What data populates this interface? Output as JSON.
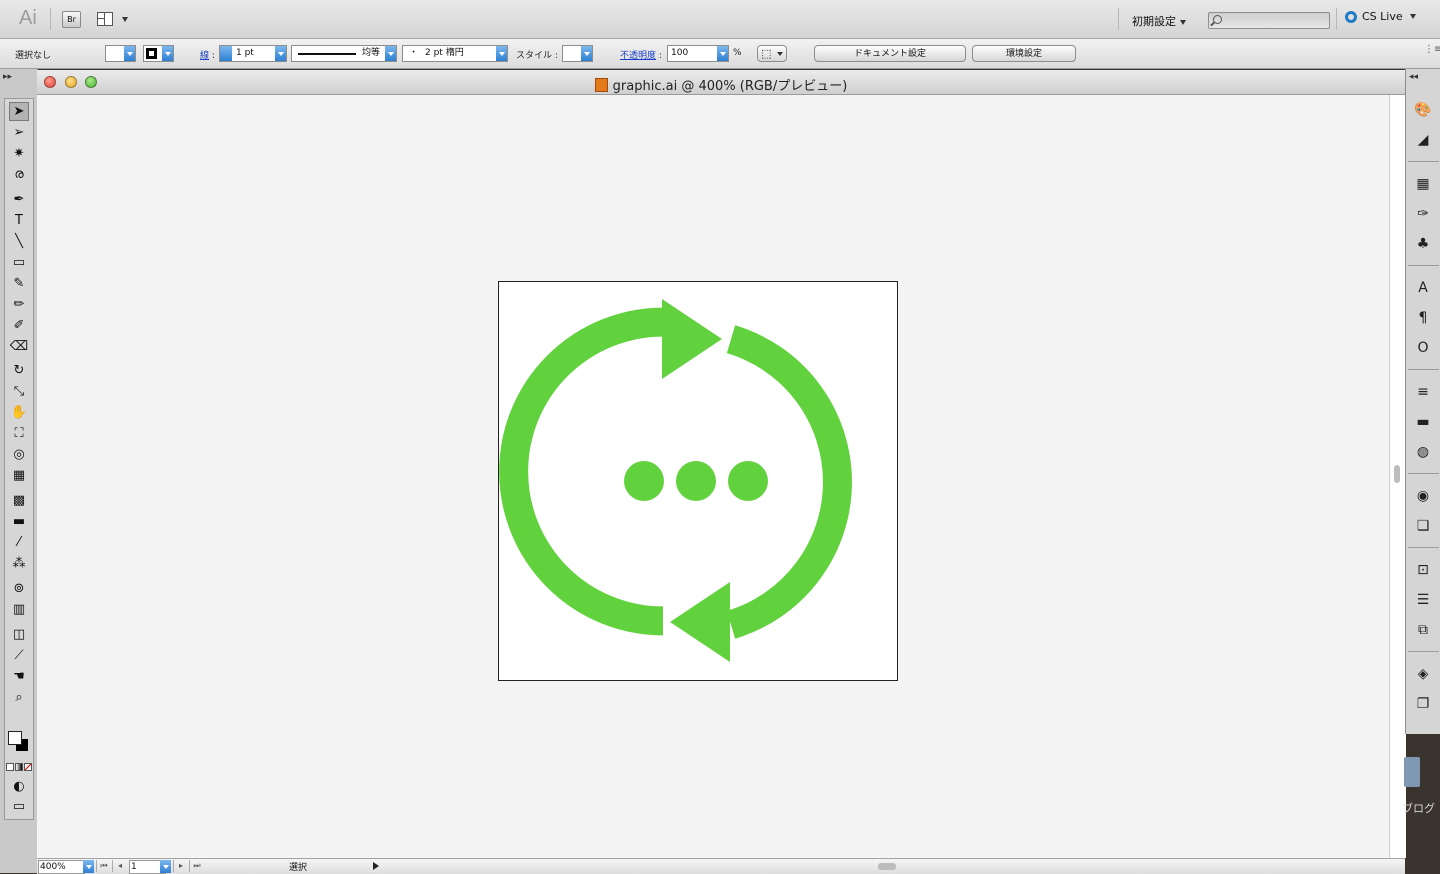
{
  "app": {
    "logo": "Ai",
    "bridge_button": "Br",
    "workspace_label": "初期設定",
    "search_placeholder": "",
    "cslive_label": "CS Live"
  },
  "control_bar": {
    "selection_label": "選択なし",
    "stroke_label": "線",
    "stroke_weight": "1 pt",
    "profile_label": "均等",
    "brush_label": "2 pt 楕円",
    "brush_prefix": "・",
    "style_label": "スタイル :",
    "opacity_label": "不透明度",
    "opacity_value": "100",
    "opacity_unit": "%",
    "document_setup_button": "ドキュメント設定",
    "preferences_button": "環境設定"
  },
  "document": {
    "title": "graphic.ai @ 400% (RGB/プレビュー)",
    "zoom_value": "400%",
    "page_value": "1",
    "status_text": "選択"
  },
  "artwork": {
    "accent_color": "#62d13e",
    "description_icon": "refresh-with-ellipsis"
  },
  "desktop": {
    "label": "ブログ"
  },
  "tools": [
    {
      "name": "selection-tool-icon",
      "glyph": "➤"
    },
    {
      "name": "direct-selection-tool-icon",
      "glyph": "➢"
    },
    {
      "name": "magic-wand-tool-icon",
      "glyph": "✷"
    },
    {
      "name": "lasso-tool-icon",
      "glyph": "ര"
    },
    {
      "name": "pen-tool-icon",
      "glyph": "✒"
    },
    {
      "name": "type-tool-icon",
      "glyph": "T"
    },
    {
      "name": "line-tool-icon",
      "glyph": "╲"
    },
    {
      "name": "rectangle-tool-icon",
      "glyph": "▭"
    },
    {
      "name": "paintbrush-tool-icon",
      "glyph": "✎"
    },
    {
      "name": "pencil-tool-icon",
      "glyph": "✏"
    },
    {
      "name": "blob-brush-tool-icon",
      "glyph": "✐"
    },
    {
      "name": "eraser-tool-icon",
      "glyph": "⌫"
    },
    {
      "name": "rotate-tool-icon",
      "glyph": "↻"
    },
    {
      "name": "scale-tool-icon",
      "glyph": "⤡"
    },
    {
      "name": "warp-tool-icon",
      "glyph": "✋"
    },
    {
      "name": "free-transform-tool-icon",
      "glyph": "⛶"
    },
    {
      "name": "shape-builder-tool-icon",
      "glyph": "◎"
    },
    {
      "name": "perspective-grid-tool-icon",
      "glyph": "▦"
    },
    {
      "name": "mesh-tool-icon",
      "glyph": "▩"
    },
    {
      "name": "gradient-tool-icon",
      "glyph": "▬"
    },
    {
      "name": "eyedropper-tool-icon",
      "glyph": "⁄"
    },
    {
      "name": "blend-tool-icon",
      "glyph": "⁂"
    },
    {
      "name": "symbol-sprayer-tool-icon",
      "glyph": "⊚"
    },
    {
      "name": "column-graph-tool-icon",
      "glyph": "▥"
    },
    {
      "name": "artboard-tool-icon",
      "glyph": "◫"
    },
    {
      "name": "slice-tool-icon",
      "glyph": "⟋"
    },
    {
      "name": "hand-tool-icon",
      "glyph": "☚"
    },
    {
      "name": "zoom-tool-icon",
      "glyph": "⌕"
    }
  ],
  "panels": [
    {
      "name": "color-panel-icon",
      "glyph": "🎨"
    },
    {
      "name": "color-guide-panel-icon",
      "glyph": "◢"
    },
    {
      "name": "swatches-panel-icon",
      "glyph": "▦"
    },
    {
      "name": "brushes-panel-icon",
      "glyph": "✑"
    },
    {
      "name": "symbols-panel-icon",
      "glyph": "♣"
    },
    {
      "name": "character-panel-icon",
      "glyph": "A"
    },
    {
      "name": "paragraph-panel-icon",
      "glyph": "¶"
    },
    {
      "name": "opentype-panel-icon",
      "glyph": "O"
    },
    {
      "name": "stroke-panel-icon",
      "glyph": "≡"
    },
    {
      "name": "gradient-panel-icon",
      "glyph": "▬"
    },
    {
      "name": "transparency-panel-icon",
      "glyph": "◍"
    },
    {
      "name": "appearance-panel-icon",
      "glyph": "◉"
    },
    {
      "name": "graphic-styles-panel-icon",
      "glyph": "❏"
    },
    {
      "name": "transform-panel-icon",
      "glyph": "⊡"
    },
    {
      "name": "align-panel-icon",
      "glyph": "☰"
    },
    {
      "name": "pathfinder-panel-icon",
      "glyph": "⧉"
    },
    {
      "name": "layers-panel-icon",
      "glyph": "◈"
    },
    {
      "name": "artboards-panel-icon",
      "glyph": "❐"
    }
  ]
}
